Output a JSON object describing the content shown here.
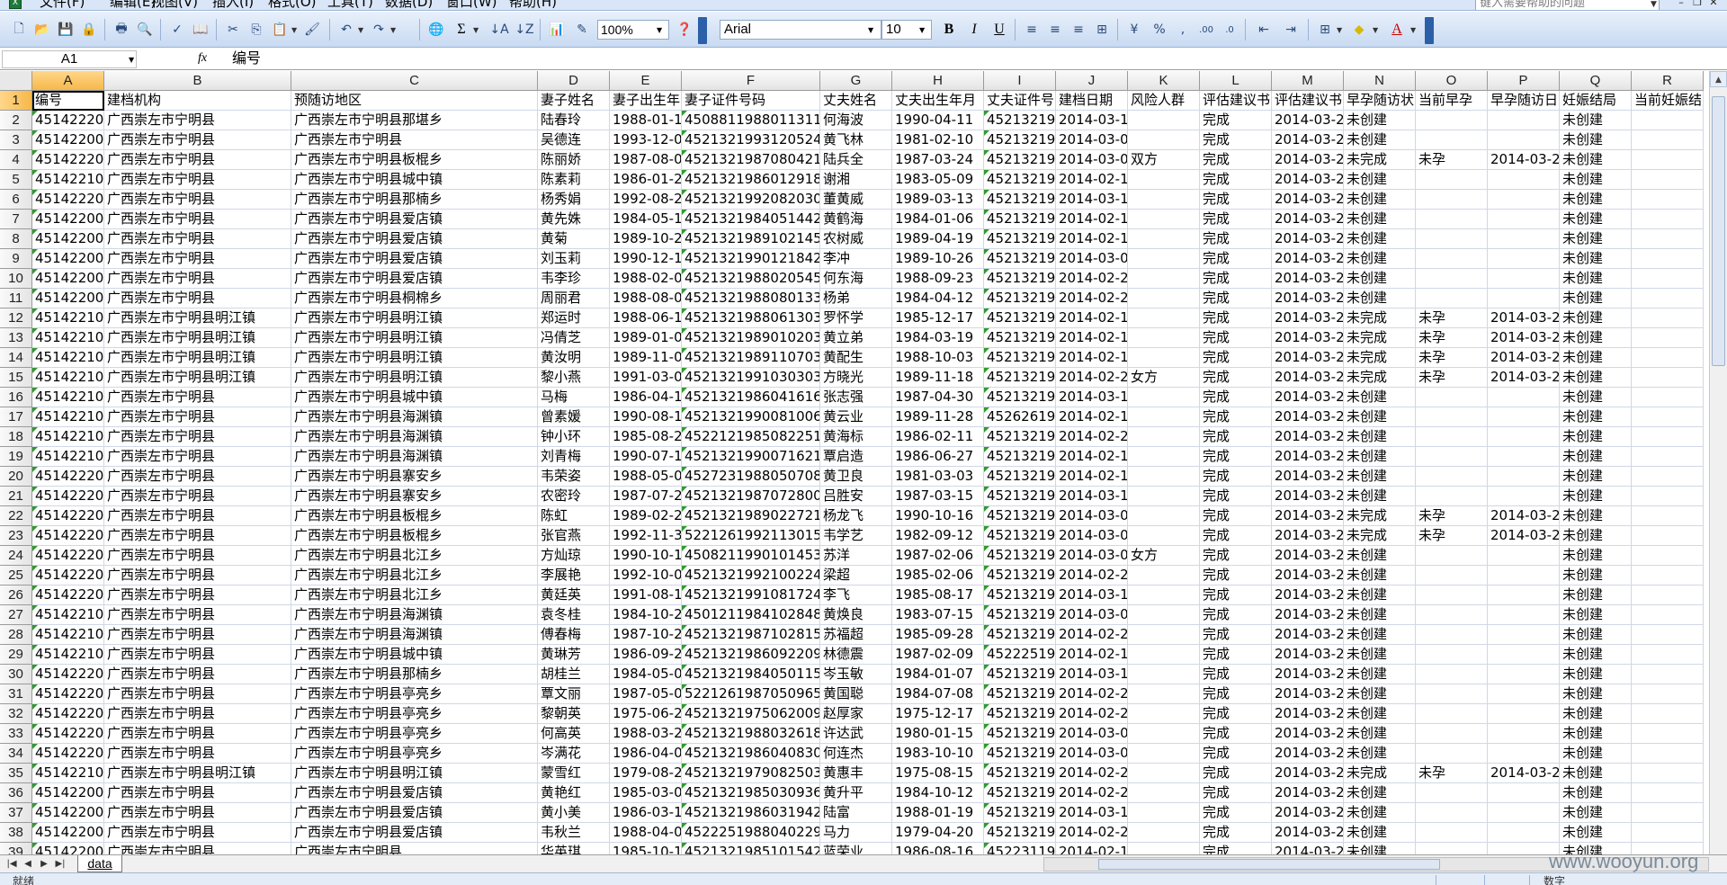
{
  "menu": {
    "items": [
      "文件(F)",
      "编辑(E)",
      "视图(V)",
      "插入(I)",
      "格式(O)",
      "工具(T)",
      "数据(D)",
      "窗口(W)",
      "帮助(H)"
    ],
    "help_placeholder": "键入需要帮助的问题"
  },
  "toolbar": {
    "zoom": "100%",
    "font": "Arial",
    "font_size": "10"
  },
  "formula_bar": {
    "cell_ref": "A1",
    "fx": "fx",
    "content": "编号"
  },
  "columns": [
    "A",
    "B",
    "C",
    "D",
    "E",
    "F",
    "G",
    "H",
    "I",
    "J",
    "K",
    "L",
    "M",
    "N",
    "O",
    "P",
    "Q",
    "R"
  ],
  "header_row": [
    "编号",
    "建档机构",
    "预随访地区",
    "妻子姓名",
    "妻子出生年",
    "妻子证件号码",
    "丈夫姓名",
    "丈夫出生年月",
    "丈夫证件号",
    "建档日期",
    "风险人群",
    "评估建议书",
    "评估建议书",
    "早孕随访状",
    "当前早孕",
    "早孕随访日",
    "妊娠结局",
    "当前妊娠结"
  ],
  "rows": [
    [
      "451422208",
      "广西崇左市宁明县",
      "广西崇左市宁明县那堪乡",
      "陆春玲",
      "1988-01-1",
      "45088119880113118",
      "何海波",
      "1990-04-11",
      "4521321990",
      "2014-03-1",
      "",
      "完成",
      "2014-03-2",
      "未创建",
      "",
      "",
      "未创建",
      ""
    ],
    [
      "451422000",
      "广西崇左市宁明县",
      "广西崇左市宁明县",
      "吴德连",
      "1993-12-0",
      "45213219931205244",
      "黄飞林",
      "1981-02-10",
      "4521321981",
      "2014-03-0",
      "",
      "完成",
      "2014-03-2",
      "未创建",
      "",
      "",
      "未创建",
      ""
    ],
    [
      "451422205",
      "广西崇左市宁明县",
      "广西崇左市宁明县板棍乡",
      "陈丽娇",
      "1987-08-0",
      "45213219870804212",
      "陆兵全",
      "1987-03-24",
      "4521321987",
      "2014-03-0",
      "双方",
      "完成",
      "2014-03-2",
      "未完成",
      "未孕",
      "2014-03-2",
      "未创建",
      ""
    ],
    [
      "451422100",
      "广西崇左市宁明县",
      "广西崇左市宁明县城中镇",
      "陈素莉",
      "1986-01-2",
      "45213219860129182",
      "谢湘",
      "1983-05-09",
      "4521321983",
      "2014-02-1",
      "",
      "完成",
      "2014-03-2",
      "未创建",
      "",
      "",
      "未创建",
      ""
    ],
    [
      "451422209",
      "广西崇左市宁明县",
      "广西崇左市宁明县那楠乡",
      "杨秀娟",
      "1992-08-2",
      "45213219920820304",
      "董黄威",
      "1989-03-13",
      "4521321989",
      "2014-03-1",
      "",
      "完成",
      "2014-03-2",
      "未创建",
      "",
      "",
      "未创建",
      ""
    ],
    [
      "451422000",
      "广西崇左市宁明县",
      "广西崇左市宁明县爱店镇",
      "黄先姝",
      "1984-05-1",
      "45213219840514422",
      "黄鹤海",
      "1984-01-06",
      "4521321984",
      "2014-02-1",
      "",
      "完成",
      "2014-03-2",
      "未创建",
      "",
      "",
      "未创建",
      ""
    ],
    [
      "451422000",
      "广西崇左市宁明县",
      "广西崇左市宁明县爱店镇",
      "黄菊",
      "1989-10-2",
      "45213219891021452",
      "农树威",
      "1989-04-19",
      "4521321989",
      "2014-02-1",
      "",
      "完成",
      "2014-03-2",
      "未创建",
      "",
      "",
      "未创建",
      ""
    ],
    [
      "451422000",
      "广西崇左市宁明县",
      "广西崇左市宁明县爱店镇",
      "刘玉莉",
      "1990-12-1",
      "45213219901218422",
      "李冲",
      "1989-10-26",
      "4521321989",
      "2014-03-0",
      "",
      "完成",
      "2014-03-2",
      "未创建",
      "",
      "",
      "未创建",
      ""
    ],
    [
      "451422000",
      "广西崇左市宁明县",
      "广西崇左市宁明县爱店镇",
      "韦李珍",
      "1988-02-0",
      "45213219880205454",
      "何东海",
      "1988-09-23",
      "4521321988",
      "2014-02-2",
      "",
      "完成",
      "2014-03-2",
      "未创建",
      "",
      "",
      "未创建",
      ""
    ],
    [
      "451422000",
      "广西崇左市宁明县",
      "广西崇左市宁明县桐棉乡",
      "周丽君",
      "1988-08-0",
      "45213219880801336",
      "杨弟",
      "1984-04-12",
      "4521321984",
      "2014-02-2",
      "",
      "完成",
      "2014-03-2",
      "未创建",
      "",
      "",
      "未创建",
      ""
    ],
    [
      "451422102",
      "广西崇左市宁明县明江镇",
      "广西崇左市宁明县明江镇",
      "郑运时",
      "1988-06-1",
      "45213219880613032",
      "罗怀学",
      "1985-12-17",
      "4521321985",
      "2014-02-1",
      "",
      "完成",
      "2014-03-2",
      "未完成",
      "未孕",
      "2014-03-2",
      "未创建",
      ""
    ],
    [
      "451422102",
      "广西崇左市宁明县明江镇",
      "广西崇左市宁明县明江镇",
      "冯倩芝",
      "1989-01-0",
      "45213219890102032",
      "黄立弟",
      "1984-03-19",
      "4521321984",
      "2014-02-1",
      "",
      "完成",
      "2014-03-2",
      "未完成",
      "未孕",
      "2014-03-2",
      "未创建",
      ""
    ],
    [
      "451422102",
      "广西崇左市宁明县明江镇",
      "广西崇左市宁明县明江镇",
      "黄汝明",
      "1989-11-0",
      "45213219891107038",
      "黄配生",
      "1988-10-03",
      "4521321988",
      "2014-02-1",
      "",
      "完成",
      "2014-03-2",
      "未完成",
      "未孕",
      "2014-03-2",
      "未创建",
      ""
    ],
    [
      "451422102",
      "广西崇左市宁明县明江镇",
      "广西崇左市宁明县明江镇",
      "黎小燕",
      "1991-03-0",
      "45213219910303032",
      "方晓光",
      "1989-11-18",
      "4521321989",
      "2014-02-2",
      "女方",
      "完成",
      "2014-03-2",
      "未完成",
      "未孕",
      "2014-03-2",
      "未创建",
      ""
    ],
    [
      "451422100",
      "广西崇左市宁明县",
      "广西崇左市宁明县城中镇",
      "马梅",
      "1986-04-1",
      "45213219860416160",
      "张志强",
      "1987-04-30",
      "4521321987",
      "2014-03-1",
      "",
      "完成",
      "2014-03-2",
      "未创建",
      "",
      "",
      "未创建",
      ""
    ],
    [
      "451422103",
      "广西崇左市宁明县",
      "广西崇左市宁明县海渊镇",
      "曾素媛",
      "1990-08-1",
      "45213219900810062",
      "黄云业",
      "1989-11-28",
      "4526261989",
      "2014-02-1",
      "",
      "完成",
      "2014-03-2",
      "未创建",
      "",
      "",
      "未创建",
      ""
    ],
    [
      "451422103",
      "广西崇左市宁明县",
      "广西崇左市宁明县海渊镇",
      "钟小环",
      "1985-08-2",
      "45221219850822514",
      "黄海标",
      "1986-02-11",
      "4521321986",
      "2014-02-2",
      "",
      "完成",
      "2014-03-2",
      "未创建",
      "",
      "",
      "未创建",
      ""
    ],
    [
      "451422103",
      "广西崇左市宁明县",
      "广西崇左市宁明县海渊镇",
      "刘青梅",
      "1990-07-1",
      "45213219900716212",
      "覃启造",
      "1986-06-27",
      "4521321986",
      "2014-02-1",
      "",
      "完成",
      "2014-03-2",
      "未创建",
      "",
      "",
      "未创建",
      ""
    ],
    [
      "451422202",
      "广西崇左市宁明县",
      "广西崇左市宁明县寨安乡",
      "韦荣姿",
      "1988-05-0",
      "45272319880507084",
      "黄卫良",
      "1981-03-03",
      "4521321981",
      "2014-02-1",
      "",
      "完成",
      "2014-03-2",
      "未创建",
      "",
      "",
      "未创建",
      ""
    ],
    [
      "451422202",
      "广西崇左市宁明县",
      "广西崇左市宁明县寨安乡",
      "农密玲",
      "1987-07-2",
      "45213219870728004",
      "吕胜安",
      "1987-03-15",
      "4521321987",
      "2014-03-1",
      "",
      "完成",
      "2014-03-2",
      "未创建",
      "",
      "",
      "未创建",
      ""
    ],
    [
      "451422205",
      "广西崇左市宁明县",
      "广西崇左市宁明县板棍乡",
      "陈虹",
      "1989-02-2",
      "45213219890227214",
      "杨龙飞",
      "1990-10-16",
      "4521321990",
      "2014-03-0",
      "",
      "完成",
      "2014-03-2",
      "未完成",
      "未孕",
      "2014-03-2",
      "未创建",
      ""
    ],
    [
      "451422205",
      "广西崇左市宁明县",
      "广西崇左市宁明县板棍乡",
      "张官燕",
      "1992-11-3",
      "52212619921130152",
      "韦学艺",
      "1982-09-12",
      "4521321982",
      "2014-03-0",
      "",
      "完成",
      "2014-03-2",
      "未完成",
      "未孕",
      "2014-03-2",
      "未创建",
      ""
    ],
    [
      "451422206",
      "广西崇左市宁明县",
      "广西崇左市宁明县北江乡",
      "方灿琼",
      "1990-10-1",
      "45082119901014532",
      "苏洋",
      "1987-02-06",
      "4521321987",
      "2014-03-0",
      "女方",
      "完成",
      "2014-03-2",
      "未创建",
      "",
      "",
      "未创建",
      ""
    ],
    [
      "451422206",
      "广西崇左市宁明县",
      "广西崇左市宁明县北江乡",
      "李展艳",
      "1992-10-0",
      "45213219921002242",
      "梁超",
      "1985-02-06",
      "4521321985",
      "2014-02-2",
      "",
      "完成",
      "2014-03-2",
      "未创建",
      "",
      "",
      "未创建",
      ""
    ],
    [
      "451422206",
      "广西崇左市宁明县",
      "广西崇左市宁明县北江乡",
      "黄廷英",
      "1991-08-1",
      "45213219910817242",
      "李飞",
      "1985-08-17",
      "4521321985",
      "2014-03-1",
      "",
      "完成",
      "2014-03-2",
      "未创建",
      "",
      "",
      "未创建",
      ""
    ],
    [
      "451422103",
      "广西崇左市宁明县",
      "广西崇左市宁明县海渊镇",
      "袁冬桂",
      "1984-10-2",
      "45012119841028482",
      "黄焕良",
      "1983-07-15",
      "4521321983",
      "2014-03-0",
      "",
      "完成",
      "2014-03-2",
      "未创建",
      "",
      "",
      "未创建",
      ""
    ],
    [
      "451422103",
      "广西崇左市宁明县",
      "广西崇左市宁明县海渊镇",
      "傅春梅",
      "1987-10-2",
      "45213219871028152",
      "苏福超",
      "1985-09-28",
      "4521321985",
      "2014-02-2",
      "",
      "完成",
      "2014-03-2",
      "未创建",
      "",
      "",
      "未创建",
      ""
    ],
    [
      "451422100",
      "广西崇左市宁明县",
      "广西崇左市宁明县城中镇",
      "黄琳芳",
      "1986-09-2",
      "45213219860922092",
      "林德震",
      "1987-02-09",
      "4522251987",
      "2014-02-1",
      "",
      "完成",
      "2014-03-2",
      "未创建",
      "",
      "",
      "未创建",
      ""
    ],
    [
      "451422209",
      "广西崇左市宁明县",
      "广西崇左市宁明县那楠乡",
      "胡桂兰",
      "1984-05-0",
      "45213219840501152",
      "岑玉敏",
      "1984-01-07",
      "4521321984",
      "2014-03-1",
      "",
      "完成",
      "2014-03-2",
      "未创建",
      "",
      "",
      "未创建",
      ""
    ],
    [
      "451422201",
      "广西崇左市宁明县",
      "广西崇左市宁明县亭亮乡",
      "覃文丽",
      "1987-05-0",
      "52212619870509652",
      "黄国聪",
      "1984-07-08",
      "4521321984",
      "2014-02-2",
      "",
      "完成",
      "2014-03-2",
      "未创建",
      "",
      "",
      "未创建",
      ""
    ],
    [
      "451422201",
      "广西崇左市宁明县",
      "广西崇左市宁明县亭亮乡",
      "黎朝英",
      "1975-06-2",
      "45213219750620094",
      "赵厚家",
      "1975-12-17",
      "4521321975",
      "2014-02-2",
      "",
      "完成",
      "2014-03-2",
      "未创建",
      "",
      "",
      "未创建",
      ""
    ],
    [
      "451422201",
      "广西崇左市宁明县",
      "广西崇左市宁明县亭亮乡",
      "何高英",
      "1988-03-2",
      "45213219880326184",
      "许达武",
      "1980-01-15",
      "4521321980",
      "2014-03-0",
      "",
      "完成",
      "2014-03-2",
      "未创建",
      "",
      "",
      "未创建",
      ""
    ],
    [
      "451422201",
      "广西崇左市宁明县",
      "广西崇左市宁明县亭亮乡",
      "岑满花",
      "1986-04-0",
      "45213219860408306",
      "何连杰",
      "1983-10-10",
      "4521321983",
      "2014-03-0",
      "",
      "完成",
      "2014-03-2",
      "未创建",
      "",
      "",
      "未创建",
      ""
    ],
    [
      "451422102",
      "广西崇左市宁明县明江镇",
      "广西崇左市宁明县明江镇",
      "蒙雪红",
      "1979-08-2",
      "45213219790825032",
      "黄惠丰",
      "1975-08-15",
      "4521321975",
      "2014-02-2",
      "",
      "完成",
      "2014-03-2",
      "未完成",
      "未孕",
      "2014-03-2",
      "未创建",
      ""
    ],
    [
      "451422000",
      "广西崇左市宁明县",
      "广西崇左市宁明县爱店镇",
      "黄艳红",
      "1985-03-0",
      "45213219850309364",
      "黄升平",
      "1984-10-12",
      "4521321984",
      "2014-02-2",
      "",
      "完成",
      "2014-03-2",
      "未创建",
      "",
      "",
      "未创建",
      ""
    ],
    [
      "451422000",
      "广西崇左市宁明县",
      "广西崇左市宁明县爱店镇",
      "黄小美",
      "1986-03-1",
      "45213219860319422",
      "陆富",
      "1988-01-19",
      "4521321988",
      "2014-03-1",
      "",
      "完成",
      "2014-03-2",
      "未创建",
      "",
      "",
      "未创建",
      ""
    ],
    [
      "451422000",
      "广西崇左市宁明县",
      "广西崇左市宁明县爱店镇",
      "韦秋兰",
      "1988-04-0",
      "45222519880402292",
      "马力",
      "1979-04-20",
      "4521321979",
      "2014-02-2",
      "",
      "完成",
      "2014-03-2",
      "未创建",
      "",
      "",
      "未创建",
      ""
    ],
    [
      "451422000",
      "广西崇左市宁明县",
      "广西崇左市宁明县",
      "华英琪",
      "1985-10-1",
      "45213219851015424",
      "蓝荣业",
      "1986-08-16",
      "4522311986",
      "2014-02-1",
      "",
      "完成",
      "2014-03-2",
      "未创建",
      "",
      "",
      "未创建",
      ""
    ]
  ],
  "sheet_tab": "data",
  "status": {
    "left": "就绪",
    "right": "数字"
  },
  "watermark": "www.wooyun.org"
}
